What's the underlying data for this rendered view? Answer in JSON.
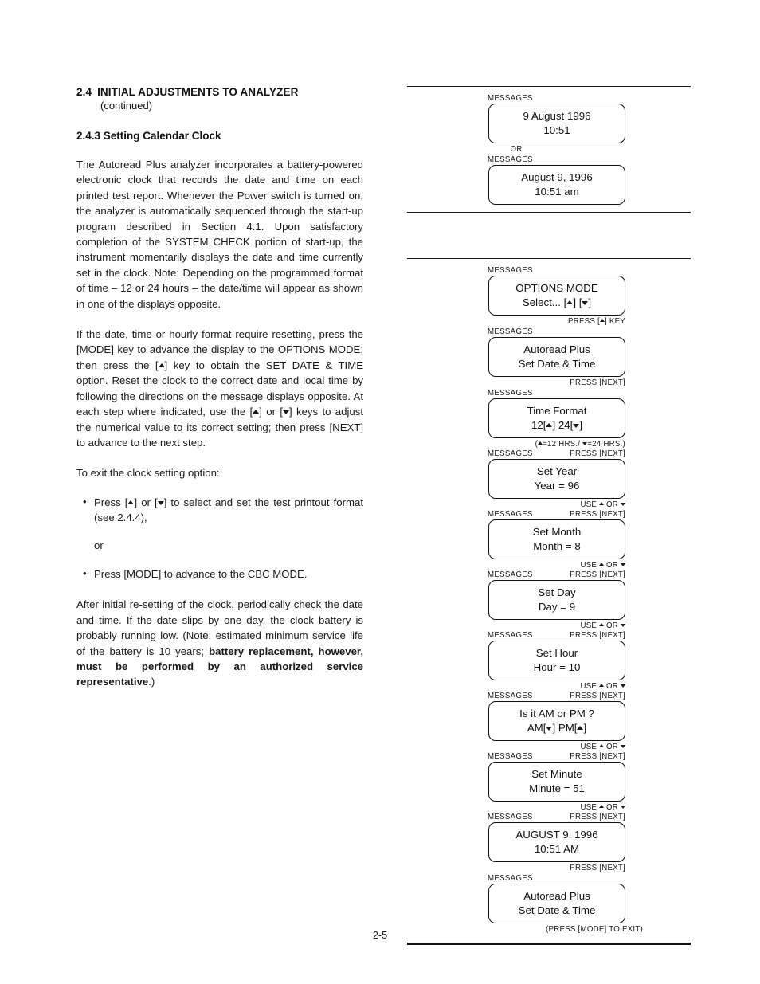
{
  "page": {
    "number": "2-5"
  },
  "left": {
    "section_number": "2.4",
    "section_title": "INITIAL ADJUSTMENTS TO ANALYZER",
    "section_continued": "(continued)",
    "subsection_title": "2.4.3 Setting Calendar Clock",
    "para1": "The Autoread Plus analyzer incorporates a battery-powered electronic clock that records the date and time on each printed test report. Whenever the Power switch is turned on, the analyzer is automatically sequenced through the start-up program described in Section 4.1. Upon satisfactory completion of the SYSTEM CHECK portion of start-up, the instrument momentarily displays the date and time currently set in the clock. Note: Depending on the programmed format of time – 12 or 24 hours – the date/time will appear as shown in one of the displays opposite.",
    "para2_a": "If the date, time or hourly format require resetting, press the [MODE] key to advance the display to the OPTIONS MODE; then press the [",
    "para2_b": "] key to obtain the SET DATE & TIME option. Reset the clock to the correct date and local time by following the directions on the message displays opposite. At each step where indicated, use the [",
    "para2_c": "] or [",
    "para2_d": "] keys to adjust the numerical value to its correct setting; then press [NEXT] to advance to the next step.",
    "para3": "To exit the clock setting option:",
    "bullet1_a": "Press [",
    "bullet1_b": "] or [",
    "bullet1_c": "] to select and set the test printout format (see 2.4.4),",
    "or_word": "or",
    "bullet2": "Press [MODE] to advance to the CBC MODE.",
    "para4_a": "After initial re-setting of the clock, periodically check the date and time. If the date slips by one day, the clock battery is probably running low. (Note: estimated minimum service life of the battery is 10 years; ",
    "para4_bold": "battery replacement, however, must be performed by an authorized service representative",
    "para4_end": ".)"
  },
  "right": {
    "messages_label": "MESSAGES",
    "or_label": "OR",
    "section1": {
      "displays": [
        {
          "line1": "9 August 1996",
          "line2": "10:51"
        },
        {
          "line1": "August 9, 1996",
          "line2": "10:51 am"
        }
      ]
    },
    "section2": {
      "steps": [
        {
          "line1": "OPTIONS MODE",
          "line2_pre": "Select... [",
          "line2_mid": "] [",
          "line2_post": "]",
          "arrow1": "up",
          "arrow2": "down",
          "note_below_pre": "PRESS [",
          "note_below_post": "] KEY",
          "note_below_arrow": "up"
        },
        {
          "line1": "Autoread Plus",
          "line2": "Set Date & Time",
          "note_below": "PRESS [NEXT]"
        },
        {
          "line1": "Time Format",
          "line2_pre": "12[",
          "line2_mid": "]  24[",
          "line2_post": "]",
          "arrow1": "up",
          "arrow2": "down",
          "note_hrs_pre": "(",
          "note_hrs_mid": "=12 HRS./ ",
          "note_hrs_post": "=24 HRS.)",
          "note_below": "PRESS [NEXT]"
        },
        {
          "line1": "Set Year",
          "line2": "Year = 96",
          "note_use_pre": "USE ",
          "note_use_mid": " OR ",
          "note_below": "PRESS [NEXT]"
        },
        {
          "line1": "Set Month",
          "line2": "Month = 8",
          "note_use_pre": "USE ",
          "note_use_mid": " OR ",
          "note_below": "PRESS [NEXT]"
        },
        {
          "line1": "Set Day",
          "line2": "Day = 9",
          "note_use_pre": "USE ",
          "note_use_mid": " OR ",
          "note_below": "PRESS [NEXT]"
        },
        {
          "line1": "Set Hour",
          "line2": "Hour = 10",
          "note_use_pre": "USE ",
          "note_use_mid": " OR ",
          "note_below": "PRESS [NEXT]"
        },
        {
          "line1": "Is it AM or PM ?",
          "line2_pre": "AM[",
          "line2_mid": "]  PM[",
          "line2_post": "]",
          "arrow1": "down",
          "arrow2": "up",
          "note_use_pre": "USE ",
          "note_use_mid": " OR ",
          "note_below": "PRESS [NEXT]"
        },
        {
          "line1": "Set Minute",
          "line2": "Minute = 51",
          "note_use_pre": "USE ",
          "note_use_mid": " OR ",
          "note_below": "PRESS [NEXT]"
        },
        {
          "line1": "AUGUST 9, 1996",
          "line2": "10:51 AM",
          "note_below": "PRESS [NEXT]"
        },
        {
          "line1": "Autoread Plus",
          "line2": "Set Date & Time",
          "note_exit": "(PRESS [MODE] TO EXIT)"
        }
      ]
    }
  }
}
